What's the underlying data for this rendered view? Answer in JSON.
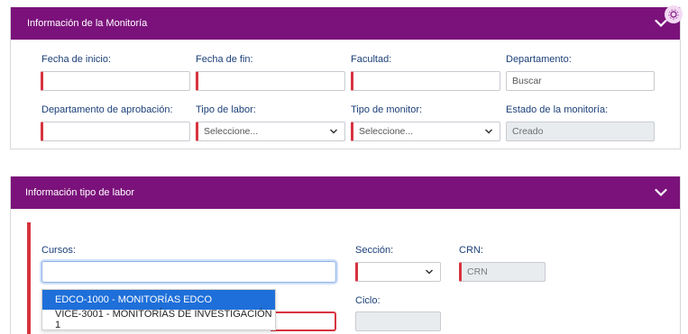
{
  "section1": {
    "title": "Información de la Monitoría",
    "fields": {
      "fecha_inicio": {
        "label": "Fecha de inicio:",
        "value": ""
      },
      "fecha_fin": {
        "label": "Fecha de fin:",
        "value": ""
      },
      "facultad": {
        "label": "Facultad:",
        "value": ""
      },
      "departamento": {
        "label": "Departamento:",
        "placeholder": "Buscar"
      },
      "depto_aprobacion": {
        "label": "Departamento de aprobación:",
        "value": ""
      },
      "tipo_labor": {
        "label": "Tipo de labor:",
        "selected": "Seleccione..."
      },
      "tipo_monitor": {
        "label": "Tipo de monitor:",
        "selected": "Seleccione..."
      },
      "estado": {
        "label": "Estado de la monitoría:",
        "value": "Creado"
      }
    }
  },
  "section2": {
    "title": "Información tipo de labor",
    "fields": {
      "cursos": {
        "label": "Cursos:",
        "value": ""
      },
      "seccion": {
        "label": "Sección:",
        "selected": ""
      },
      "crn": {
        "label": "CRN:",
        "placeholder": "CRN"
      },
      "ciclo": {
        "label": "Ciclo:",
        "value": ""
      }
    },
    "course_options": [
      "EDCO-1000 - MONITORÍAS EDCO",
      "VICE-3001 - MONITORÍAS DE INVESTIGACIÓN 1"
    ]
  },
  "colors": {
    "header_bg": "#7b127b",
    "label_text": "#1b3f78",
    "required_marker": "#d6333f",
    "dropdown_highlight": "#1e6fd9"
  },
  "icons": {
    "collapse": "chevron-down-icon",
    "select": "chevron-down-icon",
    "settings": "gear-icon"
  }
}
